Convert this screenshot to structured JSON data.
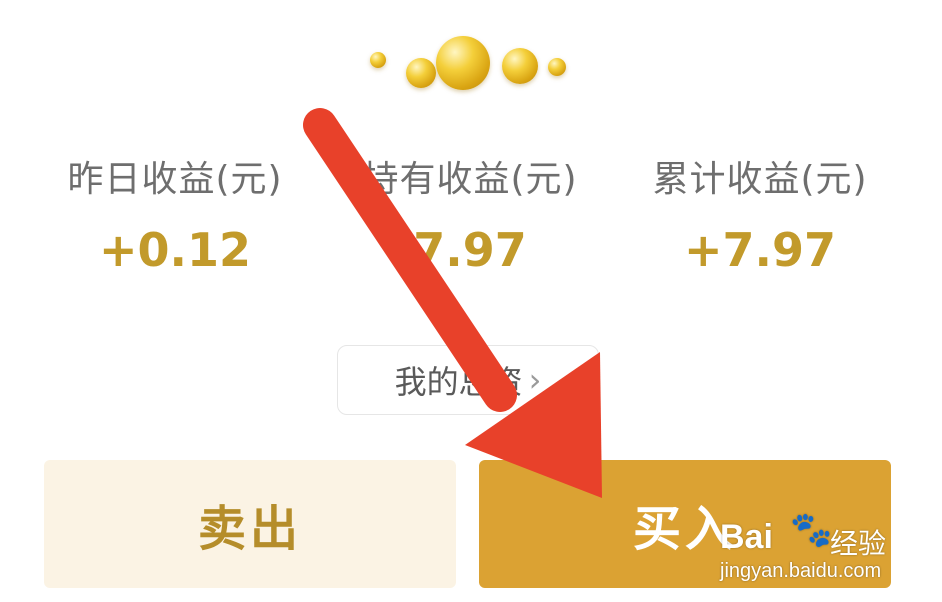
{
  "stats": [
    {
      "label": "昨日收益(元)",
      "value": "+0.12"
    },
    {
      "label": "持有收益(元)",
      "value": "7.97"
    },
    {
      "label": "累计收益(元)",
      "value": "+7.97"
    }
  ],
  "assets_link": {
    "label": "我的总资",
    "chevron": "›"
  },
  "actions": {
    "sell_label": "卖出",
    "buy_label": "买入"
  },
  "watermark": {
    "brand": "Bai",
    "paw": "🐾",
    "suffix": "经验",
    "domain": "jingyan.baidu.com"
  },
  "colors": {
    "gold_value": "#c29a2b",
    "buy_bg": "#dba233",
    "sell_bg": "#fbf3e4",
    "arrow": "#e8412a"
  }
}
